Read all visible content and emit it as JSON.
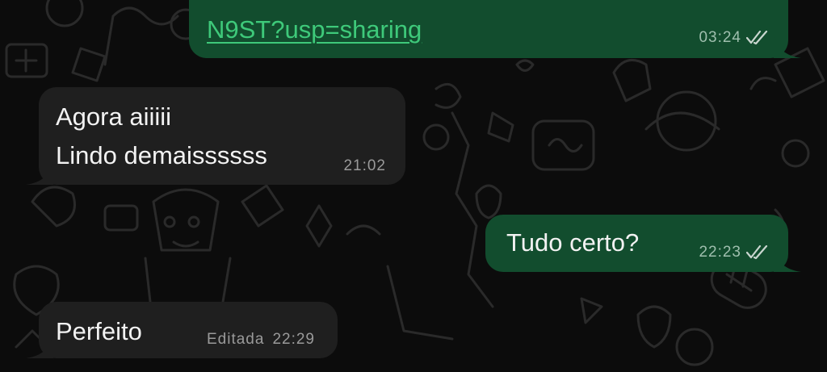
{
  "colors": {
    "incoming_bubble": "#1f1f1f",
    "outgoing_bubble": "#124d2e",
    "link": "#3ec97a",
    "tick_read_state": "#c9d6cf"
  },
  "messages": [
    {
      "direction": "outgoing",
      "text": "N9ST?usp=sharing",
      "is_link": true,
      "time": "03:24",
      "status_icon": "double-check-icon"
    },
    {
      "direction": "incoming",
      "lines": [
        "Agora aiiiii",
        "Lindo demaissssss"
      ],
      "time": "21:02"
    },
    {
      "direction": "outgoing",
      "text": "Tudo certo?",
      "time": "22:23",
      "status_icon": "double-check-icon"
    },
    {
      "direction": "incoming",
      "text": "Perfeito",
      "edited_label": "Editada",
      "time": "22:29"
    }
  ]
}
